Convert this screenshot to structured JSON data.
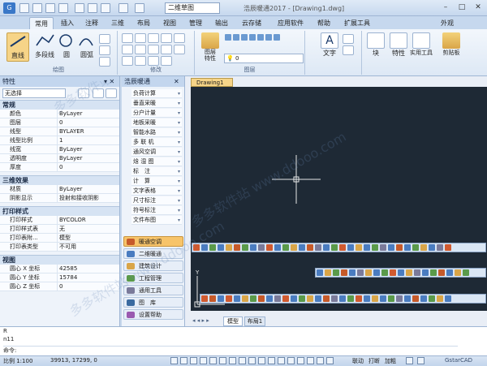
{
  "window": {
    "title": "浩辰暖通2017 - [Drawing1.dwg]",
    "workspace": "二维草图",
    "appearance": "外观"
  },
  "tabs": [
    "常用",
    "插入",
    "注释",
    "三维",
    "布局",
    "视图",
    "管理",
    "输出",
    "云存储",
    "应用软件",
    "帮助",
    "扩展工具"
  ],
  "ribbon": {
    "draw_group": "绘图",
    "modify_group": "修改",
    "layers_group": "图层",
    "line": "直线",
    "polyline": "多段线",
    "circle": "圆",
    "arc": "圆弧",
    "layer_props": "图层\n特性",
    "layer_value": "0",
    "text": "文字",
    "block": "块",
    "properties": "特性",
    "utilities": "实用工具",
    "clipboard": "剪贴板"
  },
  "props": {
    "title": "特性",
    "selection": "无选择",
    "sections": [
      {
        "name": "常规",
        "rows": [
          [
            "颜色",
            "ByLayer"
          ],
          [
            "图层",
            "0"
          ],
          [
            "线型",
            "BYLAYER"
          ],
          [
            "线型比例",
            "1"
          ],
          [
            "线宽",
            "ByLayer"
          ],
          [
            "透明度",
            "ByLayer"
          ],
          [
            "厚度",
            "0"
          ]
        ]
      },
      {
        "name": "三维效果",
        "rows": [
          [
            "材质",
            "ByLayer"
          ],
          [
            "阴影显示",
            "投射和接收阴影"
          ]
        ]
      },
      {
        "name": "打印样式",
        "rows": [
          [
            "打印样式",
            "BYCOLOR"
          ],
          [
            "打印样式表",
            "无"
          ],
          [
            "打印表附...",
            "模型"
          ],
          [
            "打印表类型",
            "不可用"
          ]
        ]
      },
      {
        "name": "视图",
        "rows": [
          [
            "圆心 X 坐标",
            "42585"
          ],
          [
            "圆心 Y 坐标",
            "15784"
          ],
          [
            "圆心 Z 坐标",
            "0"
          ]
        ]
      }
    ]
  },
  "hvac": {
    "title": "浩辰暖通",
    "items": [
      "负荷计算",
      "垂直采暖",
      "分户计量",
      "地板采暖",
      "智能水路",
      "多 联 机",
      "通风空调",
      "焓 湿 图",
      "标　注",
      "计　算",
      "文字表格",
      "尺寸标注",
      "符号标注",
      "文件布图"
    ],
    "modules": [
      "暖通空调",
      "二维暖通",
      "建筑设计",
      "工程管理",
      "通用工具",
      "图　库",
      "设置帮助"
    ]
  },
  "drawing": {
    "tab": "Drawing1",
    "layout_tabs": [
      "模型",
      "布局1"
    ]
  },
  "command": {
    "lines": [
      "R",
      "n11",
      "命令:"
    ]
  },
  "status": {
    "scale": "比例 1:100",
    "coords": "39913, 17299, 0",
    "link": "联动",
    "print": "打断",
    "add": "加粗",
    "brand": "GstarCAD"
  },
  "watermark": "多多软件站 www.ddooo.com",
  "colors": {
    "canvas": "#1e2935",
    "accent": "#f6d488",
    "panel": "#eef3fa"
  }
}
